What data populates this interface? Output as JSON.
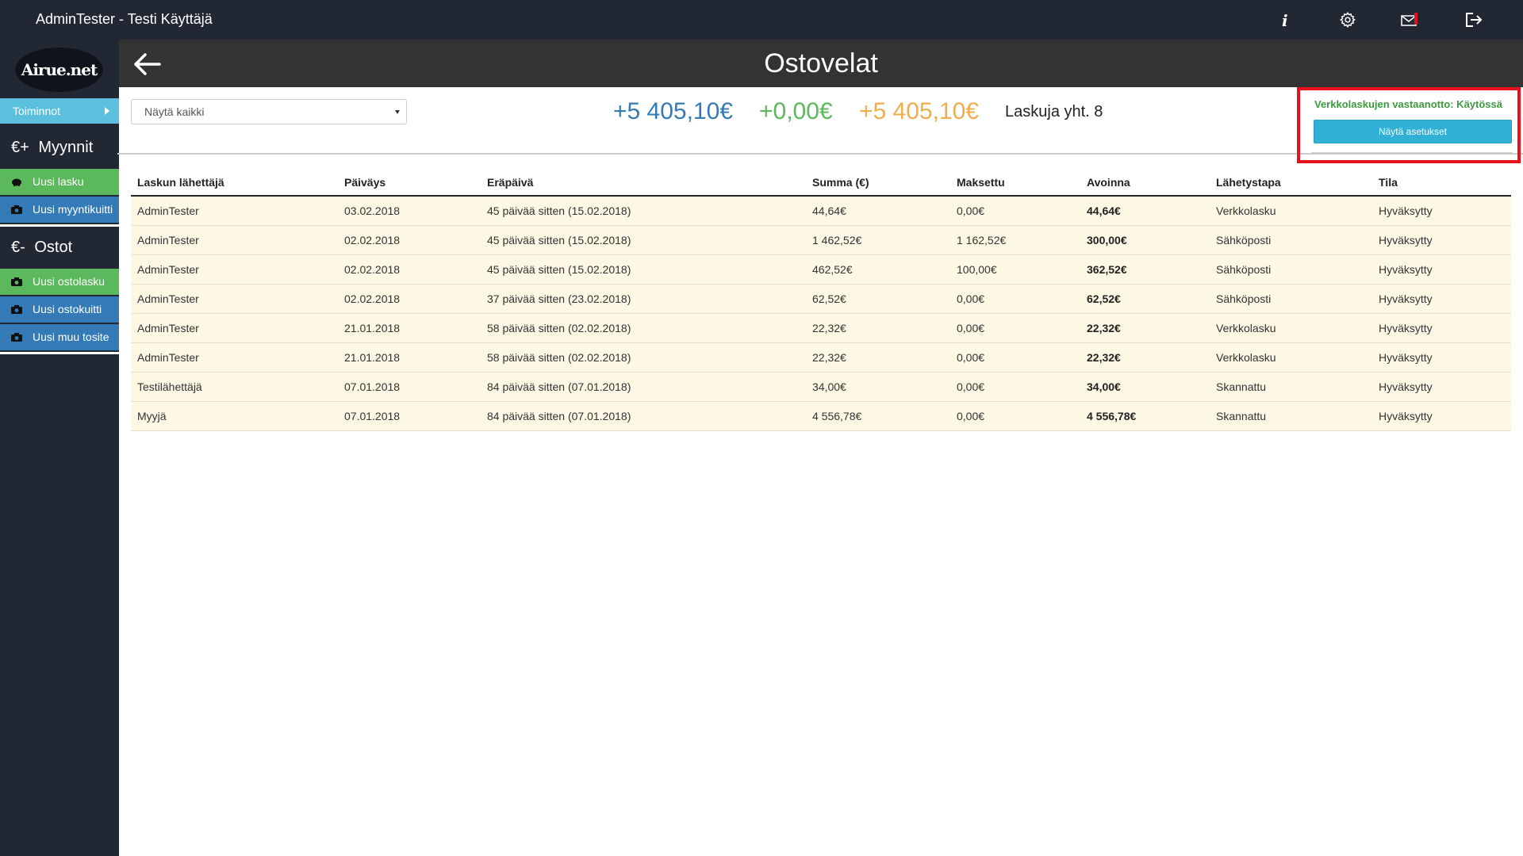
{
  "topbar": {
    "user": "AdminTester - Testi Käyttäjä",
    "icons": [
      "info-icon",
      "gear-icon",
      "mail-icon",
      "logout-icon"
    ]
  },
  "sidebar": {
    "logo": "Airue.net",
    "toiminnot": "Toiminnot",
    "myynnit": {
      "symbol": "€+",
      "title": "Myynnit",
      "items": [
        {
          "label": "Uusi lasku",
          "icon": "piggy-bank-icon",
          "color": "#5cb85c"
        },
        {
          "label": "Uusi myyntikuitti",
          "icon": "camera-icon",
          "color": "#337ab7"
        }
      ]
    },
    "ostot": {
      "symbol": "€-",
      "title": "Ostot",
      "items": [
        {
          "label": "Uusi ostolasku",
          "icon": "camera-icon",
          "color": "#5cb85c"
        },
        {
          "label": "Uusi ostokuitti",
          "icon": "camera-icon",
          "color": "#337ab7"
        },
        {
          "label": "Uusi muu tosite",
          "icon": "camera-icon",
          "color": "#337ab7"
        }
      ]
    }
  },
  "header": {
    "title": "Ostovelat"
  },
  "filter": {
    "value": "Näytä kaikki"
  },
  "totals": {
    "total": "+5 405,10€",
    "total_color": "#337ab7",
    "paid": "+0,00€",
    "paid_color": "#5cb85c",
    "open": "+5 405,10€",
    "open_color": "#f0ad4e",
    "count": "Laskuja yht. 8"
  },
  "verkkolasku": {
    "status": "Verkkolaskujen vastaanotto: Käytössä",
    "button": "Näytä asetukset"
  },
  "table": {
    "headers": [
      "Laskun lähettäjä",
      "Päiväys",
      "Eräpäivä",
      "Summa (€)",
      "Maksettu",
      "Avoinna",
      "Lähetystapa",
      "Tila"
    ],
    "rows": [
      [
        "AdminTester",
        "03.02.2018",
        "45 päivää sitten (15.02.2018)",
        "44,64€",
        "0,00€",
        "44,64€",
        "Verkkolasku",
        "Hyväksytty"
      ],
      [
        "AdminTester",
        "02.02.2018",
        "45 päivää sitten (15.02.2018)",
        "1 462,52€",
        "1 162,52€",
        "300,00€",
        "Sähköposti",
        "Hyväksytty"
      ],
      [
        "AdminTester",
        "02.02.2018",
        "45 päivää sitten (15.02.2018)",
        "462,52€",
        "100,00€",
        "362,52€",
        "Sähköposti",
        "Hyväksytty"
      ],
      [
        "AdminTester",
        "02.02.2018",
        "37 päivää sitten (23.02.2018)",
        "62,52€",
        "0,00€",
        "62,52€",
        "Sähköposti",
        "Hyväksytty"
      ],
      [
        "AdminTester",
        "21.01.2018",
        "58 päivää sitten (02.02.2018)",
        "22,32€",
        "0,00€",
        "22,32€",
        "Verkkolasku",
        "Hyväksytty"
      ],
      [
        "AdminTester",
        "21.01.2018",
        "58 päivää sitten (02.02.2018)",
        "22,32€",
        "0,00€",
        "22,32€",
        "Verkkolasku",
        "Hyväksytty"
      ],
      [
        "Testilähettäjä",
        "07.01.2018",
        "84 päivää sitten (07.01.2018)",
        "34,00€",
        "0,00€",
        "34,00€",
        "Skannattu",
        "Hyväksytty"
      ],
      [
        "Myyjä",
        "07.01.2018",
        "84 päivää sitten (07.01.2018)",
        "4 556,78€",
        "0,00€",
        "4 556,78€",
        "Skannattu",
        "Hyväksytty"
      ]
    ]
  }
}
